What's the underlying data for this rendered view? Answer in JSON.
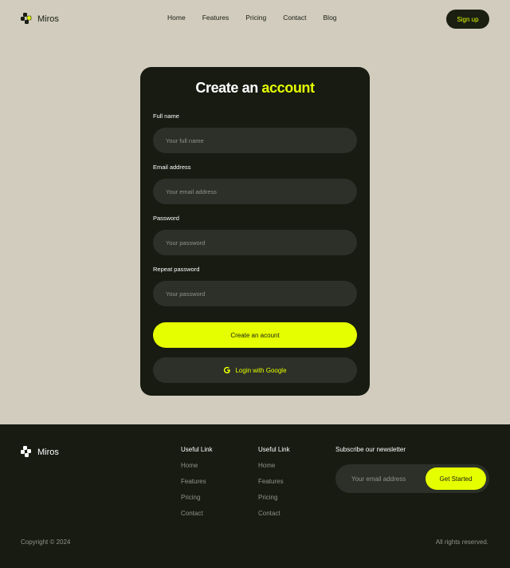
{
  "nav": {
    "brand": "Miros",
    "links": [
      "Home",
      "Features",
      "Pricing",
      "Contact",
      "Blog"
    ],
    "signup_label": "Sign up"
  },
  "form": {
    "title_main": "Create an",
    "title_accent": "account",
    "fields": [
      {
        "label": "Full name",
        "placeholder": "Your full name"
      },
      {
        "label": "Email address",
        "placeholder": "Your email address"
      },
      {
        "label": "Password",
        "placeholder": "Your password"
      },
      {
        "label": "Repeat password",
        "placeholder": "Your password"
      }
    ],
    "submit_label": "Create an acount",
    "google_label": "Login with Google"
  },
  "footer": {
    "brand": "Miros",
    "columns": [
      {
        "title": "Useful Link",
        "links": [
          "Home",
          "Features",
          "Pricing",
          "Contact"
        ]
      },
      {
        "title": "Useful Link",
        "links": [
          "Home",
          "Features",
          "Pricing",
          "Contact"
        ]
      }
    ],
    "newsletter": {
      "title": "Subscribe our newsletter",
      "placeholder": "Your email address",
      "button_label": "Get Started"
    },
    "copyright": "Copyright © 2024",
    "rights": "All rights reserved."
  },
  "colors": {
    "background": "#d1ccbd",
    "dark": "#171b11",
    "accent": "#e6ff00",
    "input_bg": "#2c3028"
  },
  "icons": {
    "brand_logo": "grid-logo-icon",
    "google": "google-g-icon"
  }
}
